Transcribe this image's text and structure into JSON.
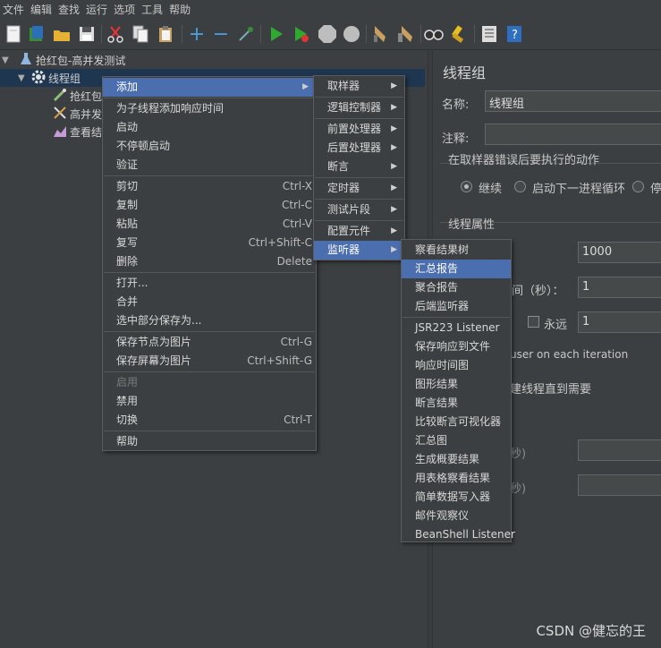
{
  "menubar": [
    "文件",
    "编辑",
    "查找",
    "运行",
    "选项",
    "工具",
    "帮助"
  ],
  "tree": {
    "root": "抢红包-高并发测试",
    "thread_group": "线程组",
    "child1": "抢红包",
    "child2": "高并发",
    "child3": "查看结"
  },
  "context_menu": {
    "add": "添加",
    "add_response_time": "为子线程添加响应时间",
    "start": "启动",
    "start_no_pause": "不停顿启动",
    "validate": "验证",
    "cut": "剪切",
    "cut_acc": "Ctrl-X",
    "copy": "复制",
    "copy_acc": "Ctrl-C",
    "paste": "粘贴",
    "paste_acc": "Ctrl-V",
    "duplicate": "复写",
    "duplicate_acc": "Ctrl+Shift-C",
    "delete": "删除",
    "delete_acc": "Delete",
    "open": "打开...",
    "merge": "合并",
    "save_selection": "选中部分保存为...",
    "save_node_image": "保存节点为图片",
    "save_node_image_acc": "Ctrl-G",
    "save_screen_image": "保存屏幕为图片",
    "save_screen_image_acc": "Ctrl+Shift-G",
    "enable": "启用",
    "disable": "禁用",
    "toggle": "切换",
    "toggle_acc": "Ctrl-T",
    "help": "帮助"
  },
  "add_submenu": {
    "sampler": "取样器",
    "logic_controller": "逻辑控制器",
    "pre_processor": "前置处理器",
    "post_processor": "后置处理器",
    "assertion": "断言",
    "timer": "定时器",
    "test_fragment": "测试片段",
    "config_element": "配置元件",
    "listener": "监听器"
  },
  "listener_submenu": {
    "view_results_tree": "察看结果树",
    "summary_report": "汇总报告",
    "aggregate_report": "聚合报告",
    "backend_listener": "后端监听器",
    "jsr223_listener": "JSR223 Listener",
    "save_responses": "保存响应到文件",
    "response_time_graph": "响应时间图",
    "graph_results": "图形结果",
    "assertion_results": "断言结果",
    "comparison_assertion_visualizer": "比较断言可视化器",
    "summary_graph": "汇总图",
    "generate_summary_results": "生成概要结果",
    "view_results_table": "用表格察看结果",
    "simple_data_writer": "简单数据写入器",
    "mailer_visualizer": "邮件观察仪",
    "beanshell_listener": "BeanShell Listener"
  },
  "right_panel": {
    "title": "线程组",
    "name_label": "名称:",
    "name_value": "线程组",
    "comment_label": "注释:",
    "comment_value": "",
    "on_error_label": "在取样器错误后要执行的动作",
    "radio_continue": "继续",
    "radio_next_loop": "启动下一进程循环",
    "radio_stop": "停",
    "thread_props": "线程属性",
    "threads_value": "1000",
    "rampup_suffix": "间（秒）：",
    "rampup_value": "1",
    "forever_label": "永远",
    "loop_value": "1",
    "same_user_text": "user on each iteration",
    "delay_text": "建线程直到需要",
    "duration_suffix": "秒)",
    "startup_suffix": "秒)"
  },
  "watermark": "CSDN @健忘的王"
}
